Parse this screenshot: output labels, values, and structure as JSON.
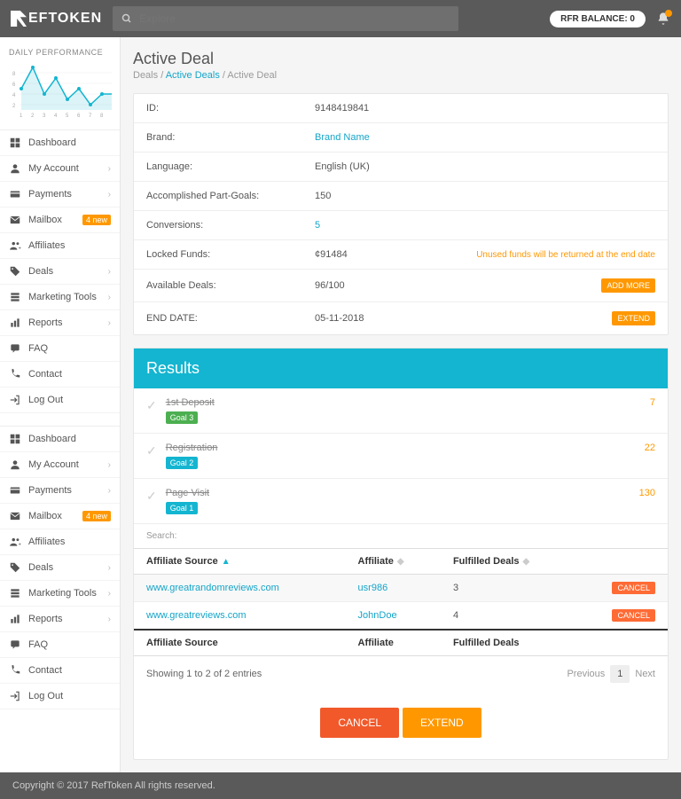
{
  "header": {
    "logo_text": "EFTOKEN",
    "search_placeholder": "Explore",
    "balance_label": "RFR BALANCE: 0"
  },
  "sidebar": {
    "chart_title": "DAILY PERFORMANCE",
    "items": [
      {
        "icon": "dashboard",
        "label": "Dashboard",
        "chev": false
      },
      {
        "icon": "account",
        "label": "My Account",
        "chev": true
      },
      {
        "icon": "payments",
        "label": "Payments",
        "chev": true
      },
      {
        "icon": "mail",
        "label": "Mailbox",
        "badge": "4 new"
      },
      {
        "icon": "affiliates",
        "label": "Affiliates",
        "chev": false
      },
      {
        "icon": "deals",
        "label": "Deals",
        "chev": true
      },
      {
        "icon": "marketing",
        "label": "Marketing Tools",
        "chev": true
      },
      {
        "icon": "reports",
        "label": "Reports",
        "chev": true
      },
      {
        "icon": "faq",
        "label": "FAQ",
        "chev": false
      },
      {
        "icon": "contact",
        "label": "Contact",
        "chev": false
      },
      {
        "icon": "logout",
        "label": "Log Out",
        "chev": false
      }
    ]
  },
  "chart_data": {
    "type": "line",
    "x": [
      1,
      2,
      3,
      4,
      5,
      6,
      7,
      8
    ],
    "values": [
      6,
      10,
      5,
      8,
      4,
      6,
      3,
      5,
      5
    ],
    "ylim": [
      2,
      10
    ],
    "xticks": [
      "1",
      "2",
      "3",
      "4",
      "5",
      "6",
      "7",
      "8"
    ],
    "yticks": [
      "2",
      "4",
      "6",
      "8"
    ]
  },
  "page": {
    "title": "Active Deal",
    "breadcrumb": {
      "root": "Deals",
      "mid": "Active Deals",
      "leaf": "Active Deal"
    }
  },
  "details": [
    {
      "label": "ID:",
      "value": "9148419841"
    },
    {
      "label": "Brand:",
      "value": "Brand Name",
      "link": true
    },
    {
      "label": "Language:",
      "value": "English (UK)"
    },
    {
      "label": "Accomplished Part-Goals:",
      "value": "150"
    },
    {
      "label": "Conversions:",
      "value": "5",
      "link": true
    },
    {
      "label": "Locked Funds:",
      "value": "¢91484",
      "note": "Unused funds will be returned at the end date"
    },
    {
      "label": "Available Deals:",
      "value": "96/100",
      "button": "ADD MORE"
    },
    {
      "label": "END DATE:",
      "value": "05-11-2018",
      "button": "EXTEND"
    }
  ],
  "results": {
    "heading": "Results",
    "rows": [
      {
        "title": "1st Deposit",
        "goal": "Goal 3",
        "goalClass": "goal-green",
        "count": "7"
      },
      {
        "title": "Registration",
        "goal": "Goal 2",
        "goalClass": "goal-teal",
        "count": "22"
      },
      {
        "title": "Page Visit",
        "goal": "Goal 1",
        "goalClass": "goal-teal",
        "count": "130"
      }
    ],
    "search_label": "Search:"
  },
  "table": {
    "headers": {
      "col1": "Affiliate Source",
      "col2": "Affiliate",
      "col3": "Fulfilled Deals"
    },
    "rows": [
      {
        "source": "www.greatrandomreviews.com",
        "affiliate": "usr986",
        "fulfilled": "3",
        "cancel": "CANCEL"
      },
      {
        "source": "www.greatreviews.com",
        "affiliate": "JohnDoe",
        "fulfilled": "4",
        "cancel": "CANCEL"
      }
    ],
    "info": "Showing 1 to 2 of 2 entries",
    "pager": {
      "prev": "Previous",
      "page": "1",
      "next": "Next"
    }
  },
  "actions": {
    "cancel": "CANCEL",
    "extend": "EXTEND"
  },
  "footer": "Copyright © 2017 RefToken All rights reserved."
}
